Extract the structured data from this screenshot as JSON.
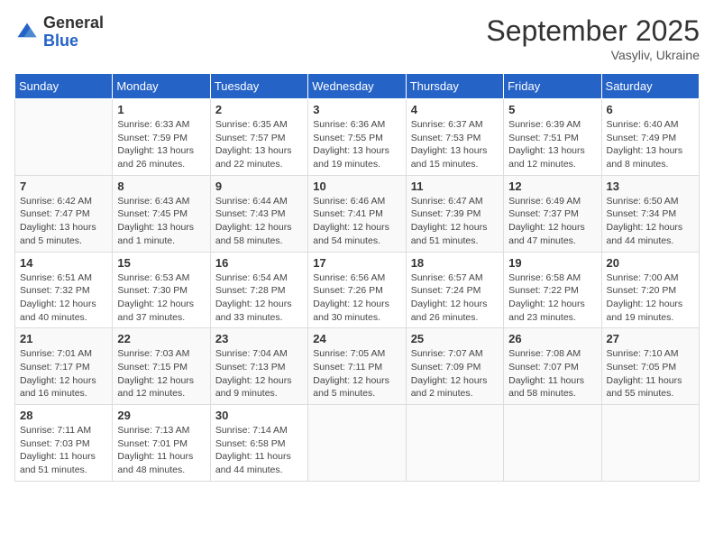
{
  "header": {
    "logo": {
      "general": "General",
      "blue": "Blue"
    },
    "title": "September 2025",
    "subtitle": "Vasyliv, Ukraine"
  },
  "days_of_week": [
    "Sunday",
    "Monday",
    "Tuesday",
    "Wednesday",
    "Thursday",
    "Friday",
    "Saturday"
  ],
  "weeks": [
    [
      {
        "day": "",
        "info": ""
      },
      {
        "day": "1",
        "info": "Sunrise: 6:33 AM\nSunset: 7:59 PM\nDaylight: 13 hours and 26 minutes."
      },
      {
        "day": "2",
        "info": "Sunrise: 6:35 AM\nSunset: 7:57 PM\nDaylight: 13 hours and 22 minutes."
      },
      {
        "day": "3",
        "info": "Sunrise: 6:36 AM\nSunset: 7:55 PM\nDaylight: 13 hours and 19 minutes."
      },
      {
        "day": "4",
        "info": "Sunrise: 6:37 AM\nSunset: 7:53 PM\nDaylight: 13 hours and 15 minutes."
      },
      {
        "day": "5",
        "info": "Sunrise: 6:39 AM\nSunset: 7:51 PM\nDaylight: 13 hours and 12 minutes."
      },
      {
        "day": "6",
        "info": "Sunrise: 6:40 AM\nSunset: 7:49 PM\nDaylight: 13 hours and 8 minutes."
      }
    ],
    [
      {
        "day": "7",
        "info": "Sunrise: 6:42 AM\nSunset: 7:47 PM\nDaylight: 13 hours and 5 minutes."
      },
      {
        "day": "8",
        "info": "Sunrise: 6:43 AM\nSunset: 7:45 PM\nDaylight: 13 hours and 1 minute."
      },
      {
        "day": "9",
        "info": "Sunrise: 6:44 AM\nSunset: 7:43 PM\nDaylight: 12 hours and 58 minutes."
      },
      {
        "day": "10",
        "info": "Sunrise: 6:46 AM\nSunset: 7:41 PM\nDaylight: 12 hours and 54 minutes."
      },
      {
        "day": "11",
        "info": "Sunrise: 6:47 AM\nSunset: 7:39 PM\nDaylight: 12 hours and 51 minutes."
      },
      {
        "day": "12",
        "info": "Sunrise: 6:49 AM\nSunset: 7:37 PM\nDaylight: 12 hours and 47 minutes."
      },
      {
        "day": "13",
        "info": "Sunrise: 6:50 AM\nSunset: 7:34 PM\nDaylight: 12 hours and 44 minutes."
      }
    ],
    [
      {
        "day": "14",
        "info": "Sunrise: 6:51 AM\nSunset: 7:32 PM\nDaylight: 12 hours and 40 minutes."
      },
      {
        "day": "15",
        "info": "Sunrise: 6:53 AM\nSunset: 7:30 PM\nDaylight: 12 hours and 37 minutes."
      },
      {
        "day": "16",
        "info": "Sunrise: 6:54 AM\nSunset: 7:28 PM\nDaylight: 12 hours and 33 minutes."
      },
      {
        "day": "17",
        "info": "Sunrise: 6:56 AM\nSunset: 7:26 PM\nDaylight: 12 hours and 30 minutes."
      },
      {
        "day": "18",
        "info": "Sunrise: 6:57 AM\nSunset: 7:24 PM\nDaylight: 12 hours and 26 minutes."
      },
      {
        "day": "19",
        "info": "Sunrise: 6:58 AM\nSunset: 7:22 PM\nDaylight: 12 hours and 23 minutes."
      },
      {
        "day": "20",
        "info": "Sunrise: 7:00 AM\nSunset: 7:20 PM\nDaylight: 12 hours and 19 minutes."
      }
    ],
    [
      {
        "day": "21",
        "info": "Sunrise: 7:01 AM\nSunset: 7:17 PM\nDaylight: 12 hours and 16 minutes."
      },
      {
        "day": "22",
        "info": "Sunrise: 7:03 AM\nSunset: 7:15 PM\nDaylight: 12 hours and 12 minutes."
      },
      {
        "day": "23",
        "info": "Sunrise: 7:04 AM\nSunset: 7:13 PM\nDaylight: 12 hours and 9 minutes."
      },
      {
        "day": "24",
        "info": "Sunrise: 7:05 AM\nSunset: 7:11 PM\nDaylight: 12 hours and 5 minutes."
      },
      {
        "day": "25",
        "info": "Sunrise: 7:07 AM\nSunset: 7:09 PM\nDaylight: 12 hours and 2 minutes."
      },
      {
        "day": "26",
        "info": "Sunrise: 7:08 AM\nSunset: 7:07 PM\nDaylight: 11 hours and 58 minutes."
      },
      {
        "day": "27",
        "info": "Sunrise: 7:10 AM\nSunset: 7:05 PM\nDaylight: 11 hours and 55 minutes."
      }
    ],
    [
      {
        "day": "28",
        "info": "Sunrise: 7:11 AM\nSunset: 7:03 PM\nDaylight: 11 hours and 51 minutes."
      },
      {
        "day": "29",
        "info": "Sunrise: 7:13 AM\nSunset: 7:01 PM\nDaylight: 11 hours and 48 minutes."
      },
      {
        "day": "30",
        "info": "Sunrise: 7:14 AM\nSunset: 6:58 PM\nDaylight: 11 hours and 44 minutes."
      },
      {
        "day": "",
        "info": ""
      },
      {
        "day": "",
        "info": ""
      },
      {
        "day": "",
        "info": ""
      },
      {
        "day": "",
        "info": ""
      }
    ]
  ]
}
